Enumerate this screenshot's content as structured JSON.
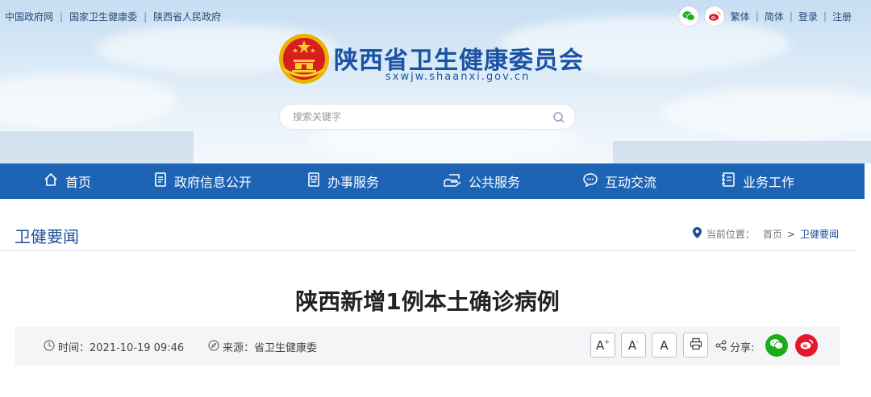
{
  "toplinks": [
    "中国政府网",
    "国家卫生健康委",
    "陕西省人民政府"
  ],
  "topright": {
    "icons": [
      "wechat-icon",
      "weibo-icon"
    ],
    "links": [
      "繁体",
      "简体",
      "登录",
      "注册"
    ]
  },
  "site": {
    "title": "陕西省卫生健康委员会",
    "domain": "sxwjw.shaanxi.gov.cn"
  },
  "search": {
    "placeholder": "搜索关键字"
  },
  "nav": [
    {
      "label": "首页",
      "icon": "home-icon"
    },
    {
      "label": "政府信息公开",
      "icon": "document-icon"
    },
    {
      "label": "办事服务",
      "icon": "service-icon"
    },
    {
      "label": "公共服务",
      "icon": "public-service-icon"
    },
    {
      "label": "互动交流",
      "icon": "chat-icon"
    },
    {
      "label": "业务工作",
      "icon": "work-icon"
    }
  ],
  "section": {
    "title": "卫健要闻",
    "location_label": "当前位置：",
    "crumbs": [
      "首页",
      "卫健要闻"
    ],
    "crumb_sep": ">"
  },
  "article": {
    "title": "陕西新增1例本土确诊病例",
    "time_label": "时间：2021-10-19 09:46",
    "source_label": "来源：省卫生健康委",
    "font_buttons": [
      "A",
      "A",
      "A"
    ],
    "font_marks": [
      "+",
      "-",
      ""
    ],
    "share_label": "分享:"
  },
  "colors": {
    "brand": "#1b53a4",
    "nav_bg": "#1e64b4",
    "wechat": "#1aad19",
    "weibo": "#e6162d"
  }
}
